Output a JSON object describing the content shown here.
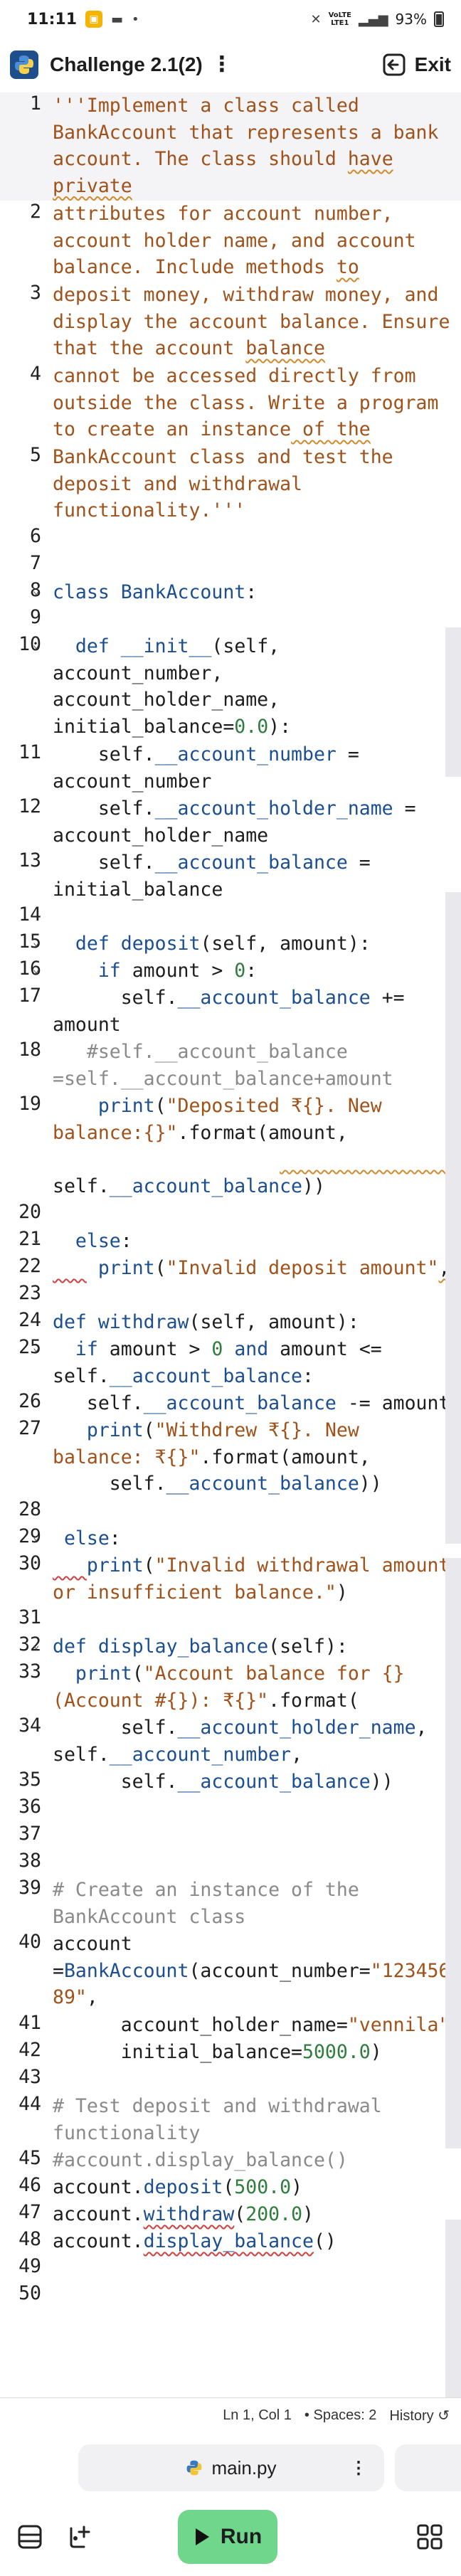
{
  "status_bar": {
    "time": "11:11",
    "net_label_1": "VoLTE",
    "net_label_2": "LTE1",
    "battery": "93%"
  },
  "header": {
    "title": "Challenge 2.1(2)",
    "exit_label": "Exit"
  },
  "editor_status": {
    "position": "Ln 1, Col 1",
    "spaces": "Spaces: 2",
    "history": "History"
  },
  "file_tab": {
    "name": "main.py"
  },
  "run_label": "Run",
  "icons": {
    "logo": "python-logo",
    "menu": "more-vertical-icon",
    "exit": "exit-icon",
    "history": "history-icon",
    "file": "python-file-icon",
    "run": "play-icon"
  }
}
